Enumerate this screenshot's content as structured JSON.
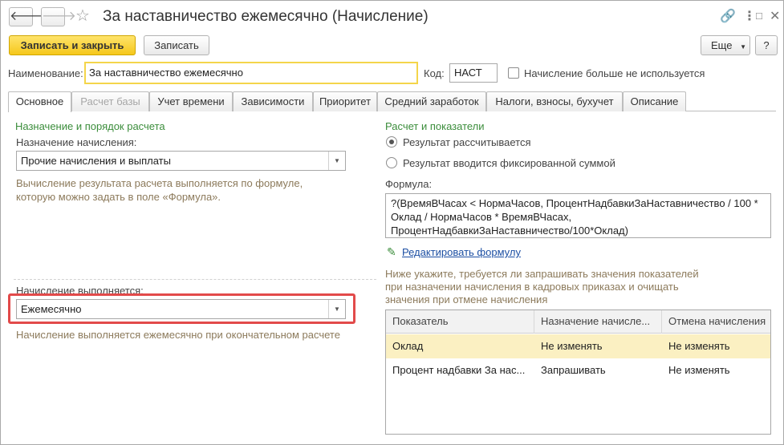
{
  "window": {
    "title": "За наставничество ежемесячно (Начисление)"
  },
  "toolbar": {
    "save_close_label": "Записать и закрыть",
    "save_label": "Записать",
    "more_label": "Еще",
    "help_label": "?"
  },
  "form": {
    "name_label": "Наименование:",
    "name_value": "За наставничество ежемесячно",
    "code_label": "Код:",
    "code_value": "НАСТ",
    "unused_label": "Начисление больше не используется"
  },
  "tabs": [
    {
      "label": "Основное"
    },
    {
      "label": "Расчет базы"
    },
    {
      "label": "Учет времени"
    },
    {
      "label": "Зависимости"
    },
    {
      "label": "Приоритет"
    },
    {
      "label": "Средний заработок"
    },
    {
      "label": "Налоги, взносы, бухучет"
    },
    {
      "label": "Описание"
    }
  ],
  "left": {
    "section_title": "Назначение и порядок расчета",
    "purpose_label": "Назначение начисления:",
    "purpose_value": "Прочие начисления и выплаты",
    "purpose_hint_1": "Вычисление результата расчета выполняется по формуле,",
    "purpose_hint_2": "которую можно задать в поле «Формула».",
    "exec_label": "Начисление выполняется:",
    "exec_value": "Ежемесячно",
    "exec_hint": "Начисление выполняется ежемесячно при окончательном расчете"
  },
  "right": {
    "section_title": "Расчет и показатели",
    "radio_calculated": "Результат рассчитывается",
    "radio_fixed": "Результат вводится фиксированной суммой",
    "formula_label": "Формула:",
    "formula_lines": [
      "?(ВремяВЧасах < НормаЧасов, ПроцентНадбавкиЗаНаставничество / 100 *",
      "Оклад / НормаЧасов * ВремяВЧасах,",
      "ПроцентНадбавкиЗаНаставничество/100*Оклад)"
    ],
    "edit_formula_link": "Редактировать формулу",
    "indicators_hint_1": "Ниже укажите, требуется ли запрашивать значения показателей",
    "indicators_hint_2": "при назначении начисления в кадровых приказах и очищать",
    "indicators_hint_3": "значения при отмене начисления",
    "table": {
      "headers": [
        "Показатель",
        "Назначение начисле...",
        "Отмена начисления"
      ],
      "rows": [
        [
          "Оклад",
          "Не изменять",
          "Не изменять"
        ],
        [
          "Процент надбавки За нас...",
          "Запрашивать",
          "Не изменять"
        ]
      ]
    }
  },
  "colors": {
    "accent_yellow": "#f5c71b",
    "section_green": "#3b8d3b",
    "hint_brown": "#8c7a5b",
    "highlight_red": "#e24a4a",
    "selected_row": "#fbf0c2"
  },
  "icons": {
    "back": "arrow-left-icon",
    "forward": "arrow-right-icon",
    "favorite": "star-icon",
    "link": "link-icon",
    "menu": "more-vertical-icon",
    "maximize": "maximize-icon",
    "close": "close-icon",
    "edit": "pencil-icon"
  }
}
